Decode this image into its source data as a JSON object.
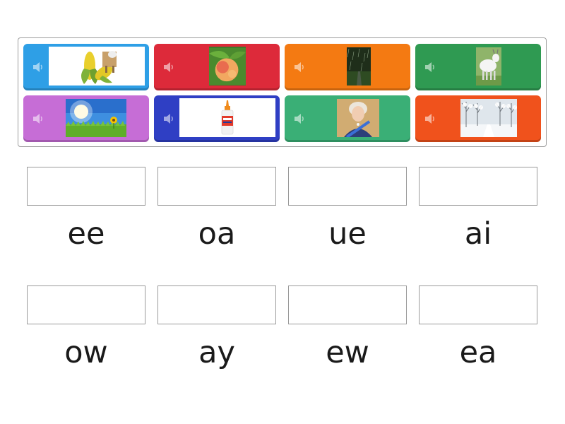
{
  "tiles": [
    {
      "color": "#2e9fe6",
      "picture": "corn-and-goat-icon",
      "audio_icon": "speaker-icon"
    },
    {
      "color": "#dd2a3a",
      "picture": "peach-icon",
      "audio_icon": "speaker-icon"
    },
    {
      "color": "#f47a12",
      "picture": "rain-icon",
      "audio_icon": "speaker-icon"
    },
    {
      "color": "#2f9a52",
      "picture": "goat-icon",
      "audio_icon": "speaker-icon"
    },
    {
      "color": "#c66dd6",
      "picture": "sun-field-icon",
      "audio_icon": "speaker-icon"
    },
    {
      "color": "#2f3fc4",
      "picture": "glue-bottle-icon",
      "audio_icon": "speaker-icon"
    },
    {
      "color": "#3aaf76",
      "picture": "queen-icon",
      "audio_icon": "speaker-icon"
    },
    {
      "color": "#f0521c",
      "picture": "snowy-trees-icon",
      "audio_icon": "speaker-icon"
    }
  ],
  "targets": [
    {
      "label": "ee"
    },
    {
      "label": "oa"
    },
    {
      "label": "ue"
    },
    {
      "label": "ai"
    },
    {
      "label": "ow"
    },
    {
      "label": "ay"
    },
    {
      "label": "ew"
    },
    {
      "label": "ea"
    }
  ]
}
